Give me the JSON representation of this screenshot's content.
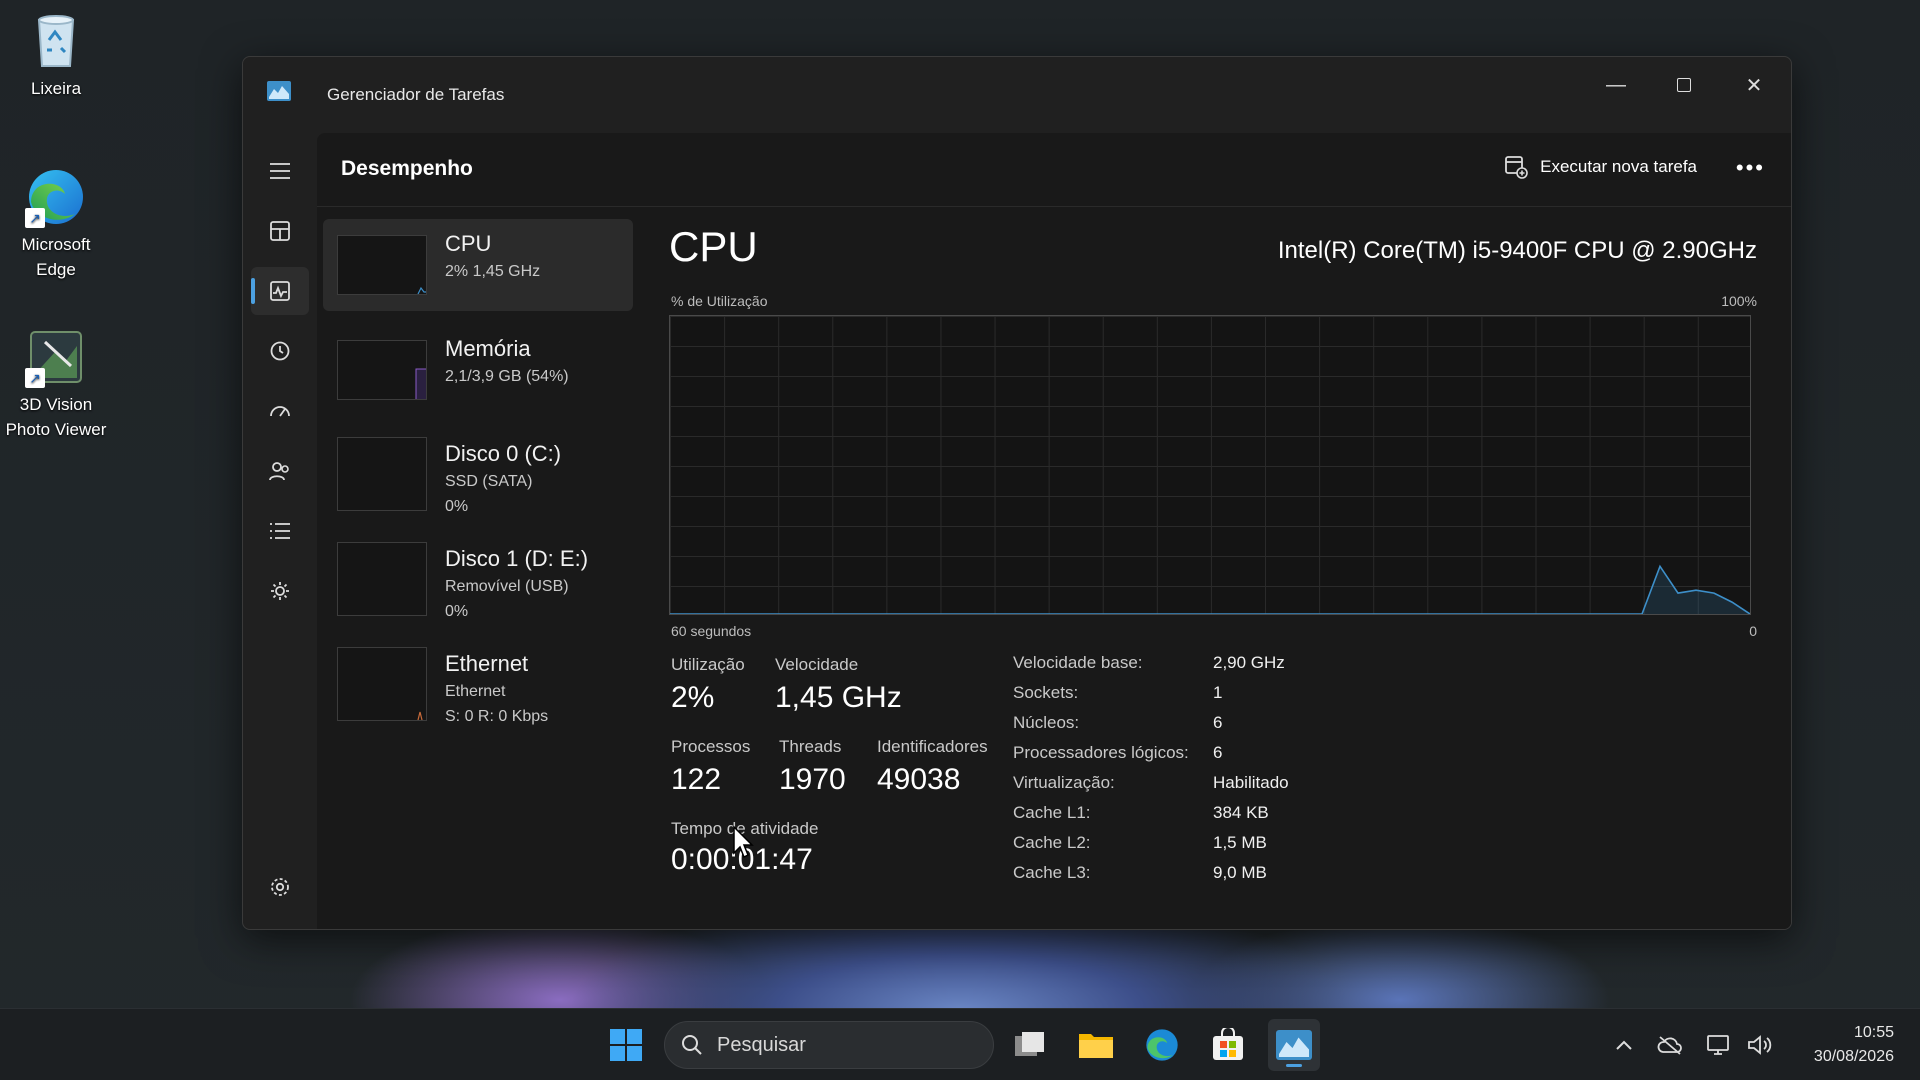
{
  "desktop": {
    "icons": [
      {
        "label": "Lixeira"
      },
      {
        "label": "Microsoft Edge"
      },
      {
        "label": "3D Vision Photo Viewer"
      }
    ]
  },
  "window": {
    "title": "Gerenciador de Tarefas",
    "page_title": "Desempenho",
    "run_task_label": "Executar nova tarefa",
    "more_label": "•••"
  },
  "devices": [
    {
      "name": "CPU",
      "line1": "2%  1,45 GHz",
      "line2": ""
    },
    {
      "name": "Memória",
      "line1": "2,1/3,9 GB (54%)",
      "line2": ""
    },
    {
      "name": "Disco 0 (C:)",
      "line1": "SSD (SATA)",
      "line2": "0%"
    },
    {
      "name": "Disco 1 (D: E:)",
      "line1": "Removível (USB)",
      "line2": "0%"
    },
    {
      "name": "Ethernet",
      "line1": "Ethernet",
      "line2": "S: 0  R: 0 Kbps"
    }
  ],
  "cpu": {
    "title": "CPU",
    "model": "Intel(R) Core(TM) i5-9400F CPU @ 2.90GHz",
    "graph_label_top_left": "% de Utilização",
    "graph_label_top_right": "100%",
    "graph_label_bottom_left": "60 segundos",
    "graph_label_bottom_right": "0",
    "stats": {
      "utilizacao_label": "Utilização",
      "utilizacao_value": "2%",
      "velocidade_label": "Velocidade",
      "velocidade_value": "1,45 GHz",
      "processos_label": "Processos",
      "processos_value": "122",
      "threads_label": "Threads",
      "threads_value": "1970",
      "identificadores_label": "Identificadores",
      "identificadores_value": "49038",
      "tempo_label": "Tempo de atividade",
      "tempo_value": "0:00:01:47"
    },
    "specs": [
      {
        "key": "Velocidade base:",
        "value": "2,90 GHz"
      },
      {
        "key": "Sockets:",
        "value": "1"
      },
      {
        "key": "Núcleos:",
        "value": "6"
      },
      {
        "key": "Processadores lógicos:",
        "value": "6"
      },
      {
        "key": "Virtualização:",
        "value": "Habilitado"
      },
      {
        "key": "Cache L1:",
        "value": "384 KB"
      },
      {
        "key": "Cache L2:",
        "value": "1,5 MB"
      },
      {
        "key": "Cache L3:",
        "value": "9,0 MB"
      }
    ],
    "utilization_history": [
      0,
      0,
      0,
      0,
      0,
      0,
      0,
      0,
      0,
      0,
      0,
      0,
      0,
      0,
      0,
      0,
      0,
      0,
      0,
      0,
      0,
      0,
      0,
      0,
      0,
      0,
      0,
      0,
      0,
      0,
      0,
      0,
      0,
      0,
      0,
      0,
      0,
      0,
      0,
      0,
      0,
      0,
      0,
      0,
      0,
      0,
      0,
      0,
      0,
      0,
      0,
      0,
      0,
      0,
      0,
      16,
      7,
      8,
      7,
      4,
      0
    ]
  },
  "taskbar": {
    "search_placeholder": "Pesquisar",
    "time": "10:55",
    "date": "30/08/2026"
  },
  "colors": {
    "accent": "#4ca0e0",
    "cpu_graph": "#3d8fc9",
    "memory_graph": "#8a5cc8",
    "ethernet_graph": "#c86a3a"
  }
}
